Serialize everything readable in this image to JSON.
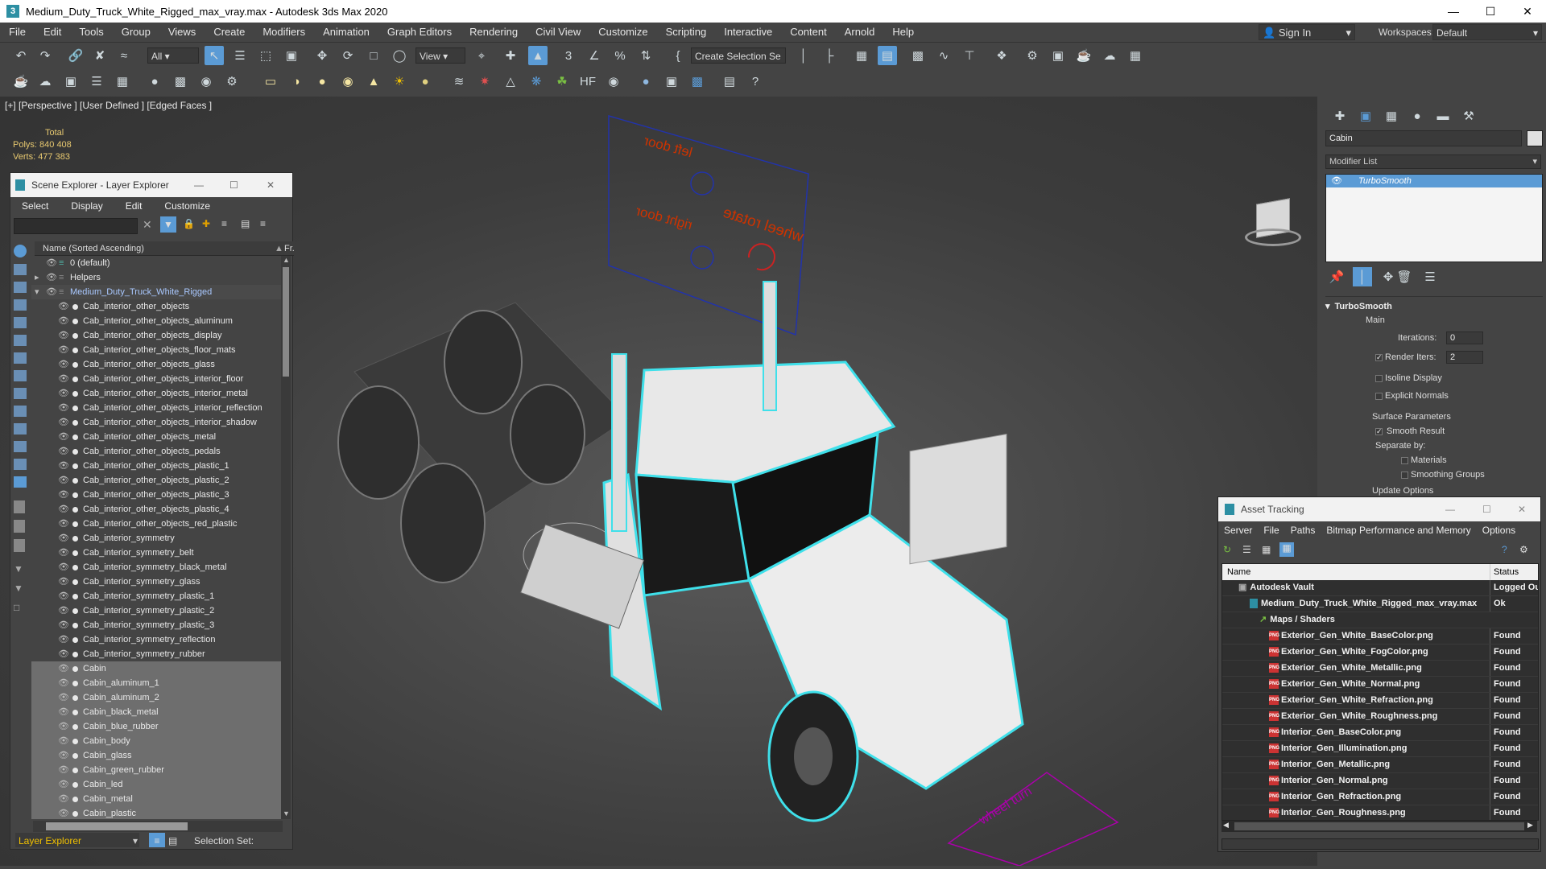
{
  "window": {
    "title": "Medium_Duty_Truck_White_Rigged_max_vray.max - Autodesk 3ds Max 2020"
  },
  "menu": [
    "File",
    "Edit",
    "Tools",
    "Group",
    "Views",
    "Create",
    "Modifiers",
    "Animation",
    "Graph Editors",
    "Rendering",
    "Civil View",
    "Customize",
    "Scripting",
    "Interactive",
    "Content",
    "Arnold",
    "Help"
  ],
  "signin": "Sign In",
  "workspaces": {
    "label": "Workspaces:",
    "value": "Default"
  },
  "toolbar": {
    "filter": "All",
    "refcoord": "View",
    "selset": "Create Selection Se"
  },
  "viewport": {
    "label": "[+] [Perspective ] [User Defined ] [Edged Faces ]",
    "stats": {
      "total": "Total",
      "polys_label": "Polys:",
      "polys": "840 408",
      "verts_label": "Verts:",
      "verts": "477 383"
    }
  },
  "scene_explorer": {
    "title": "Scene Explorer - Layer Explorer",
    "menu": [
      "Select",
      "Display",
      "Edit",
      "Customize"
    ],
    "column_header": "Name (Sorted Ascending)",
    "column_header2": "Fr.",
    "rows": [
      {
        "label": "0 (default)",
        "level": 0
      },
      {
        "label": "Helpers",
        "level": 0
      },
      {
        "label": "Medium_Duty_Truck_White_Rigged",
        "level": 0
      },
      {
        "label": "Cab_interior_other_objects",
        "level": 1
      },
      {
        "label": "Cab_interior_other_objects_aluminum",
        "level": 1
      },
      {
        "label": "Cab_interior_other_objects_display",
        "level": 1
      },
      {
        "label": "Cab_interior_other_objects_floor_mats",
        "level": 1
      },
      {
        "label": "Cab_interior_other_objects_glass",
        "level": 1
      },
      {
        "label": "Cab_interior_other_objects_interior_floor",
        "level": 1
      },
      {
        "label": "Cab_interior_other_objects_interior_metal",
        "level": 1
      },
      {
        "label": "Cab_interior_other_objects_interior_reflection",
        "level": 1
      },
      {
        "label": "Cab_interior_other_objects_interior_shadow",
        "level": 1
      },
      {
        "label": "Cab_interior_other_objects_metal",
        "level": 1
      },
      {
        "label": "Cab_interior_other_objects_pedals",
        "level": 1
      },
      {
        "label": "Cab_interior_other_objects_plastic_1",
        "level": 1
      },
      {
        "label": "Cab_interior_other_objects_plastic_2",
        "level": 1
      },
      {
        "label": "Cab_interior_other_objects_plastic_3",
        "level": 1
      },
      {
        "label": "Cab_interior_other_objects_plastic_4",
        "level": 1
      },
      {
        "label": "Cab_interior_other_objects_red_plastic",
        "level": 1
      },
      {
        "label": "Cab_interior_symmetry",
        "level": 1
      },
      {
        "label": "Cab_interior_symmetry_belt",
        "level": 1
      },
      {
        "label": "Cab_interior_symmetry_black_metal",
        "level": 1
      },
      {
        "label": "Cab_interior_symmetry_glass",
        "level": 1
      },
      {
        "label": "Cab_interior_symmetry_plastic_1",
        "level": 1
      },
      {
        "label": "Cab_interior_symmetry_plastic_2",
        "level": 1
      },
      {
        "label": "Cab_interior_symmetry_plastic_3",
        "level": 1
      },
      {
        "label": "Cab_interior_symmetry_reflection",
        "level": 1
      },
      {
        "label": "Cab_interior_symmetry_rubber",
        "level": 1
      },
      {
        "label": "Cabin",
        "level": 1
      },
      {
        "label": "Cabin_aluminum_1",
        "level": 1
      },
      {
        "label": "Cabin_aluminum_2",
        "level": 1
      },
      {
        "label": "Cabin_black_metal",
        "level": 1
      },
      {
        "label": "Cabin_blue_rubber",
        "level": 1
      },
      {
        "label": "Cabin_body",
        "level": 1
      },
      {
        "label": "Cabin_glass",
        "level": 1
      },
      {
        "label": "Cabin_green_rubber",
        "level": 1
      },
      {
        "label": "Cabin_led",
        "level": 1
      },
      {
        "label": "Cabin_metal",
        "level": 1
      },
      {
        "label": "Cabin_plastic",
        "level": 1
      }
    ],
    "footer": {
      "explorer": "Layer Explorer",
      "selset": "Selection Set:"
    }
  },
  "command_panel": {
    "object_name": "Cabin",
    "modifier_list": "Modifier List",
    "modifier": "TurboSmooth",
    "rollout": "TurboSmooth",
    "main": "Main",
    "iterations_label": "Iterations:",
    "iterations": "0",
    "render_iters_label": "Render Iters:",
    "render_iters": "2",
    "isoline": "Isoline Display",
    "explicit": "Explicit Normals",
    "surface": "Surface Parameters",
    "smooth": "Smooth Result",
    "separate": "Separate by:",
    "materials": "Materials",
    "smoothing_groups": "Smoothing Groups",
    "update": "Update Options"
  },
  "asset_tracking": {
    "title": "Asset Tracking",
    "menu": [
      "Server",
      "File",
      "Paths",
      "Bitmap Performance and Memory",
      "Options"
    ],
    "col_name": "Name",
    "col_status": "Status",
    "rows": [
      {
        "name": "Autodesk Vault",
        "status": "Logged Ou",
        "level": 1
      },
      {
        "name": "Medium_Duty_Truck_White_Rigged_max_vray.max",
        "status": "Ok",
        "level": 2
      },
      {
        "name": "Maps / Shaders",
        "status": "",
        "level": 3
      },
      {
        "name": "Exterior_Gen_White_BaseColor.png",
        "status": "Found",
        "level": 4
      },
      {
        "name": "Exterior_Gen_White_FogColor.png",
        "status": "Found",
        "level": 4
      },
      {
        "name": "Exterior_Gen_White_Metallic.png",
        "status": "Found",
        "level": 4
      },
      {
        "name": "Exterior_Gen_White_Normal.png",
        "status": "Found",
        "level": 4
      },
      {
        "name": "Exterior_Gen_White_Refraction.png",
        "status": "Found",
        "level": 4
      },
      {
        "name": "Exterior_Gen_White_Roughness.png",
        "status": "Found",
        "level": 4
      },
      {
        "name": "Interior_Gen_BaseColor.png",
        "status": "Found",
        "level": 4
      },
      {
        "name": "Interior_Gen_Illumination.png",
        "status": "Found",
        "level": 4
      },
      {
        "name": "Interior_Gen_Metallic.png",
        "status": "Found",
        "level": 4
      },
      {
        "name": "Interior_Gen_Normal.png",
        "status": "Found",
        "level": 4
      },
      {
        "name": "Interior_Gen_Refraction.png",
        "status": "Found",
        "level": 4
      },
      {
        "name": "Interior_Gen_Roughness.png",
        "status": "Found",
        "level": 4
      }
    ]
  },
  "scene_labels": {
    "left_door": "left door",
    "right_door": "right door",
    "wheel_rotate": "wheel rotate",
    "wheel_turn": "wheel turn"
  },
  "colors": {
    "accent": "#5b9bd5",
    "selection_outline": "#3fe0ea",
    "stats": "#e8c970",
    "scene_label": "#cc3300"
  }
}
